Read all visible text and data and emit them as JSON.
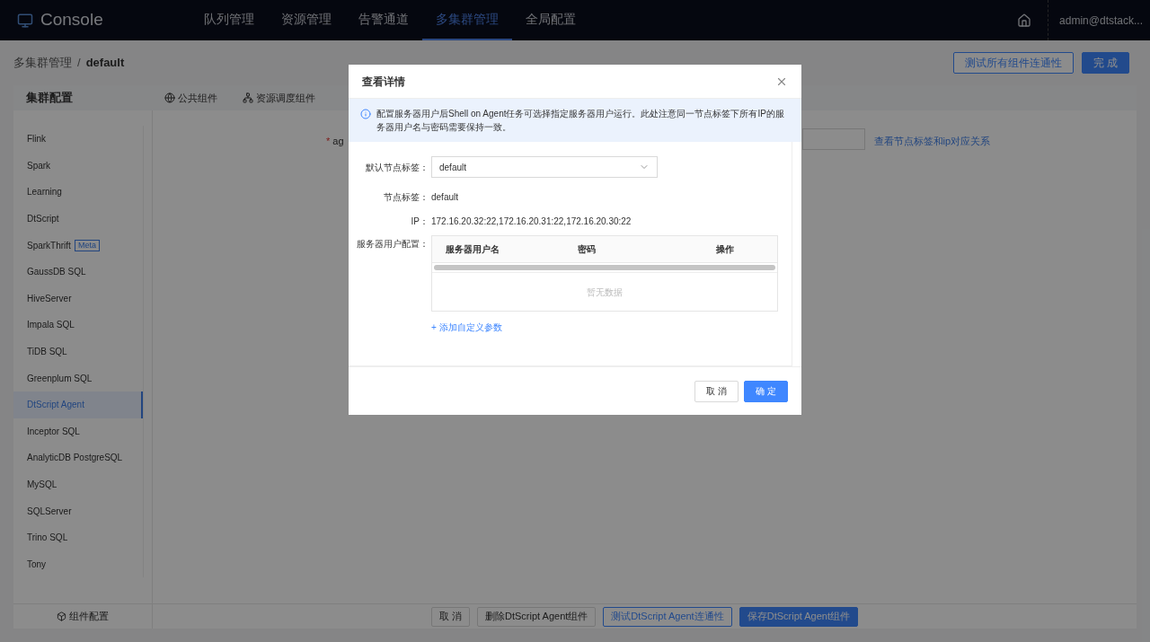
{
  "header": {
    "logo": "Console",
    "nav": [
      {
        "label": "队列管理",
        "selected": false
      },
      {
        "label": "资源管理",
        "selected": false
      },
      {
        "label": "告警通道",
        "selected": false
      },
      {
        "label": "多集群管理",
        "selected": true
      },
      {
        "label": "全局配置",
        "selected": false
      }
    ],
    "user": "admin@dtstack..."
  },
  "breadcrumb": {
    "items": [
      "多集群管理",
      "default"
    ],
    "separator": "/"
  },
  "toolbar_buttons": [
    {
      "label": "测试所有组件连通性",
      "kind": "outline"
    },
    {
      "label": "完 成",
      "kind": "primary"
    }
  ],
  "panel": {
    "title": "集群配置",
    "tabs": [
      {
        "label": "公共组件",
        "kind": "globe"
      },
      {
        "label": "资源调度组件",
        "kind": "network"
      }
    ]
  },
  "sidebar": {
    "items": [
      {
        "label": "Flink",
        "selected": false
      },
      {
        "label": "Spark",
        "selected": false
      },
      {
        "label": "Learning",
        "selected": false
      },
      {
        "label": "DtScript",
        "selected": false
      },
      {
        "label": "SparkThrift",
        "selected": false,
        "badge": "Meta"
      },
      {
        "label": "GaussDB SQL",
        "selected": false
      },
      {
        "label": "HiveServer",
        "selected": false
      },
      {
        "label": "Impala SQL",
        "selected": false
      },
      {
        "label": "TiDB SQL",
        "selected": false
      },
      {
        "label": "Greenplum SQL",
        "selected": false
      },
      {
        "label": "DtScript Agent",
        "selected": true
      },
      {
        "label": "Inceptor SQL",
        "selected": false
      },
      {
        "label": "AnalyticDB PostgreSQL",
        "selected": false
      },
      {
        "label": "MySQL",
        "selected": false
      },
      {
        "label": "SQLServer",
        "selected": false
      },
      {
        "label": "Trino SQL",
        "selected": false
      },
      {
        "label": "Tony",
        "selected": false
      }
    ],
    "footer": "组件配置"
  },
  "form": {
    "required_mark": "*",
    "field_label": "ag",
    "link": "查看节点标签和ip对应关系"
  },
  "footer_buttons": [
    {
      "label": "取 消",
      "kind": "default"
    },
    {
      "label": "删除DtScript Agent组件",
      "kind": "default"
    },
    {
      "label": "测试DtScript Agent连通性",
      "kind": "outline"
    },
    {
      "label": "保存DtScript Agent组件",
      "kind": "primary"
    }
  ],
  "dialog": {
    "title": "查看详情",
    "alert": "配置服务器用户后Shell on Agent任务可选择指定服务器用户运行。此处注意同一节点标签下所有IP的服务器用户名与密码需要保持一致。",
    "default_tag": {
      "label": "默认节点标签：",
      "value": "default"
    },
    "tag": {
      "label": "节点标签：",
      "value": "default"
    },
    "ip": {
      "label": "IP：",
      "value": "172.16.20.32:22,172.16.20.31:22,172.16.20.30:22"
    },
    "users": {
      "label": "服务器用户配置：",
      "columns": [
        "服务器用户名",
        "密码",
        "操作"
      ],
      "empty": "暂无数据"
    },
    "add_link": "+ 添加自定义参数",
    "buttons": [
      {
        "label": "取 消",
        "kind": "default"
      },
      {
        "label": "确 定",
        "kind": "primary"
      }
    ]
  }
}
